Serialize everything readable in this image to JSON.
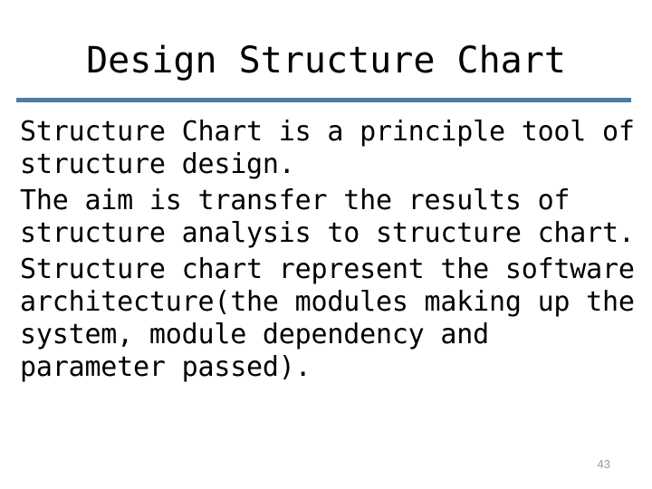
{
  "slide": {
    "title": "Design Structure Chart",
    "accent_color": "#4F7CA3",
    "background_color": "#FFFFFF",
    "text_color": "#000000",
    "page_number": "43",
    "page_number_color": "#9A9A9A",
    "paragraphs": [
      {
        "id": "definition",
        "text": "Structure Chart is a principle tool of structure design."
      },
      {
        "id": "aim",
        "text": "The aim is transfer the results of structure analysis to structure chart."
      },
      {
        "id": "representation",
        "text": "Structure chart represent the software architecture(the modules making up the system, module dependency and parameter passed)."
      }
    ]
  }
}
